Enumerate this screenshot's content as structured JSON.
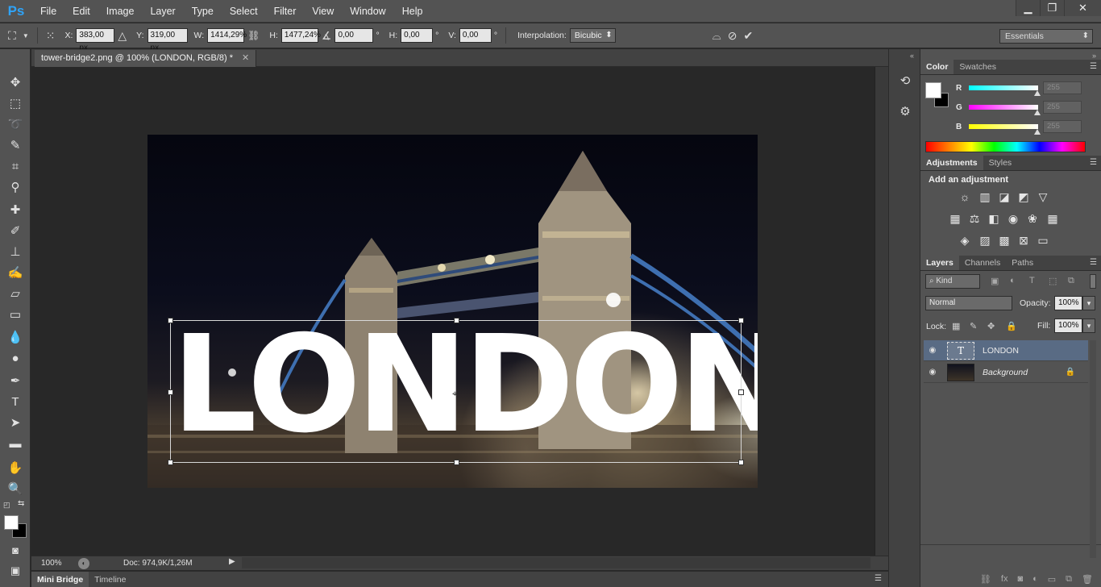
{
  "app": {
    "logo": "Ps"
  },
  "menu": [
    "File",
    "Edit",
    "Image",
    "Layer",
    "Type",
    "Select",
    "Filter",
    "View",
    "Window",
    "Help"
  ],
  "window_controls": {
    "minimize": "▁",
    "restore": "❐",
    "close": "✕"
  },
  "options": {
    "x_label": "X:",
    "x_value": "383,00 px",
    "y_label": "Y:",
    "y_value": "319,00 px",
    "w_label": "W:",
    "w_value": "1414,29%",
    "h_label": "H:",
    "h_value": "1477,24%",
    "angle_value": "0,00",
    "angle_unit": "°",
    "hskew_label": "H:",
    "hskew_value": "0,00",
    "hskew_unit": "°",
    "vskew_label": "V:",
    "vskew_value": "0,00",
    "vskew_unit": "°",
    "interp_label": "Interpolation:",
    "interp_value": "Bicubic",
    "workspace": "Essentials"
  },
  "document": {
    "tab_title": "tower-bridge2.png @ 100% (LONDON, RGB/8) *",
    "text_layer": "LONDON"
  },
  "status": {
    "zoom": "100%",
    "doc_info": "Doc: 974,9K/1,26M"
  },
  "bottom_tabs": [
    "Mini Bridge",
    "Timeline"
  ],
  "color_panel": {
    "tabs": [
      "Color",
      "Swatches"
    ],
    "sliders": [
      {
        "letter": "R",
        "value": "255",
        "color": "#00ffff"
      },
      {
        "letter": "G",
        "value": "255",
        "color": "#ff00ff"
      },
      {
        "letter": "B",
        "value": "255",
        "color": "#ffff00"
      }
    ],
    "foreground": "#ffffff",
    "background": "#000000"
  },
  "adjustments": {
    "tabs": [
      "Adjustments",
      "Styles"
    ],
    "heading": "Add an adjustment"
  },
  "layers_panel": {
    "tabs": [
      "Layers",
      "Channels",
      "Paths"
    ],
    "kind": "Kind",
    "blend_mode": "Normal",
    "opacity_label": "Opacity:",
    "opacity": "100%",
    "lock_label": "Lock:",
    "fill_label": "Fill:",
    "fill": "100%",
    "layers": [
      {
        "name": "LONDON",
        "type": "text",
        "selected": true
      },
      {
        "name": "Background",
        "type": "image",
        "locked": true
      }
    ]
  }
}
